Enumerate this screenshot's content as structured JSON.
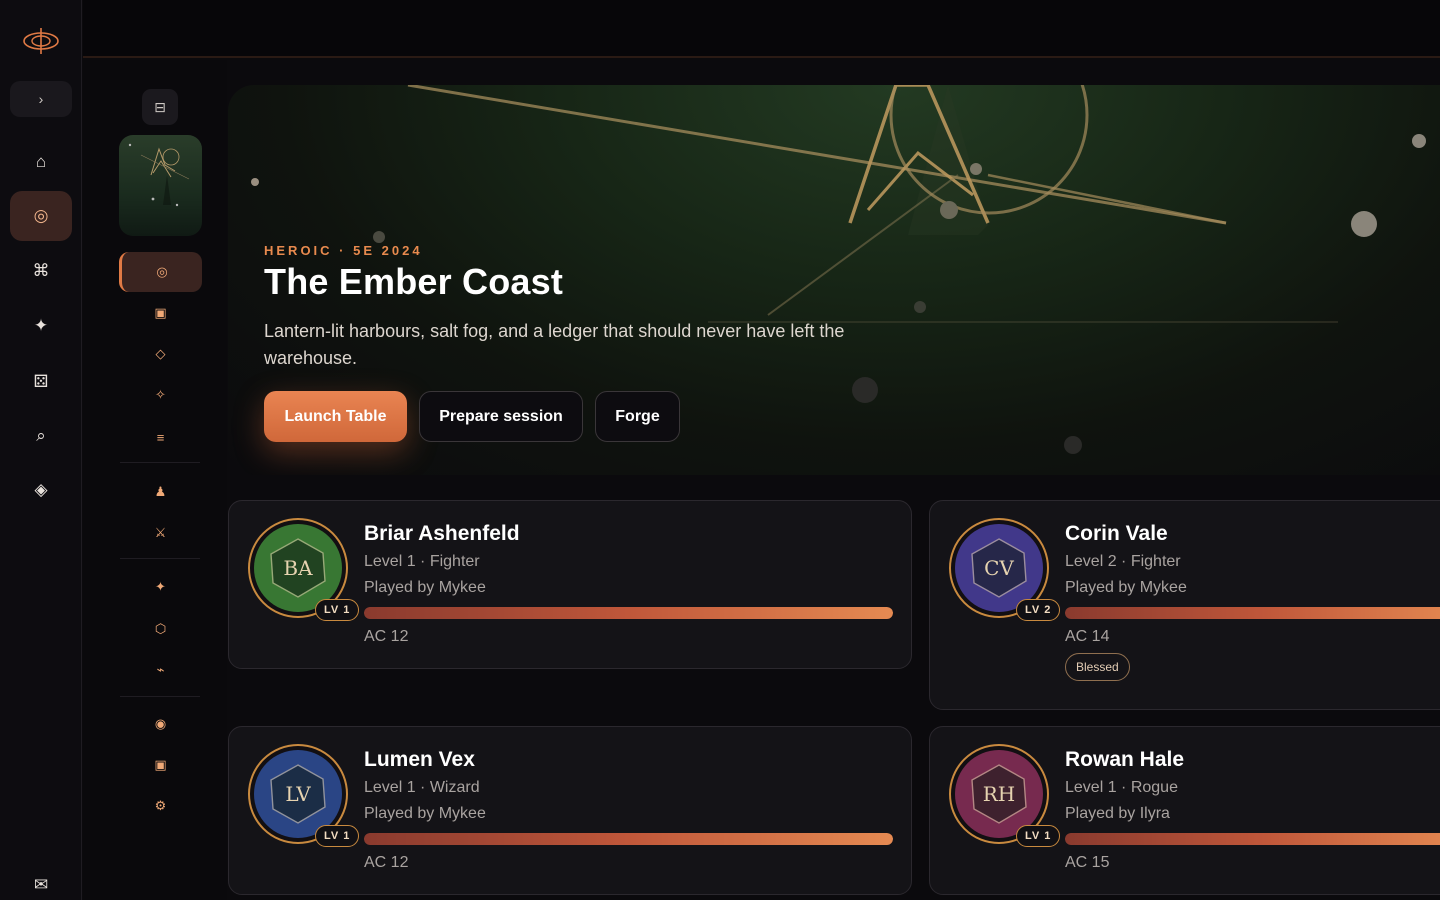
{
  "rail": {
    "toggle_glyph": "›",
    "items": [
      {
        "icon": "home-icon",
        "glyph": "⌂"
      },
      {
        "icon": "campaign-icon",
        "glyph": "◎",
        "active": true
      },
      {
        "icon": "command-icon",
        "glyph": "⌘"
      },
      {
        "icon": "sparkle-icon",
        "glyph": "✦"
      },
      {
        "icon": "dice-icon",
        "glyph": "⚄"
      },
      {
        "icon": "search-icon",
        "glyph": "⌕"
      },
      {
        "icon": "gem-icon",
        "glyph": "◈"
      }
    ],
    "bottom_glyph": "✉"
  },
  "col2": {
    "collapse_glyph": "⊟",
    "items": [
      {
        "icon": "overview-icon",
        "glyph": "◎",
        "active": true
      },
      {
        "icon": "scene-icon",
        "glyph": "▣"
      },
      {
        "icon": "map-icon",
        "glyph": "◇"
      },
      {
        "icon": "spark-icon",
        "glyph": "✧"
      },
      {
        "icon": "notes-icon",
        "glyph": "≡"
      },
      {
        "icon": "pawn-icon",
        "glyph": "♟"
      },
      {
        "icon": "crossed-swords-icon",
        "glyph": "⚔"
      },
      {
        "icon": "magic-icon",
        "glyph": "✦"
      },
      {
        "icon": "hex-icon",
        "glyph": "⬡"
      },
      {
        "icon": "link-icon",
        "glyph": "⌁"
      },
      {
        "icon": "orb-icon",
        "glyph": "◉"
      },
      {
        "icon": "frame-icon",
        "glyph": "▣"
      },
      {
        "icon": "settings-icon",
        "glyph": "⚙"
      }
    ]
  },
  "hero": {
    "kicker": "HEROIC · 5E 2024",
    "title": "The Ember Coast",
    "description": "Lantern-lit harbours, salt fog, and a ledger that should never have left the warehouse.",
    "buttons": {
      "launch": "Launch Table",
      "prepare": "Prepare session",
      "forge": "Forge"
    }
  },
  "characters": [
    {
      "initials": "BA",
      "name": "Briar Ashenfeld",
      "meta": "Level 1 · Fighter",
      "played_by": "Played by Mykee",
      "level_badge": "LV 1",
      "ac": "AC 12",
      "hp_fraction": 1.0,
      "color": "#3f8a3a",
      "ring": "#5a9a3a"
    },
    {
      "initials": "CV",
      "name": "Corin Vale",
      "meta": "Level 2 · Fighter",
      "played_by": "Played by Mykee",
      "level_badge": "LV 2",
      "ac": "AC 14",
      "hp_fraction": 1.0,
      "badge": "Blessed",
      "color": "#4a3fa0",
      "ring": "#5b4bb5"
    },
    {
      "initials": "LV",
      "name": "Lumen Vex",
      "meta": "Level 1 · Wizard",
      "played_by": "Played by Mykee",
      "level_badge": "LV 1",
      "ac": "AC 12",
      "hp_fraction": 1.0,
      "color": "#2f4f9a",
      "ring": "#3a5fb0"
    },
    {
      "initials": "RH",
      "name": "Rowan Hale",
      "meta": "Level 1 · Rogue",
      "played_by": "Played by Ilyra",
      "level_badge": "LV 1",
      "ac": "AC 15",
      "hp_fraction": 1.0,
      "color": "#8a2f5a",
      "ring": "#a03a6a"
    }
  ]
}
